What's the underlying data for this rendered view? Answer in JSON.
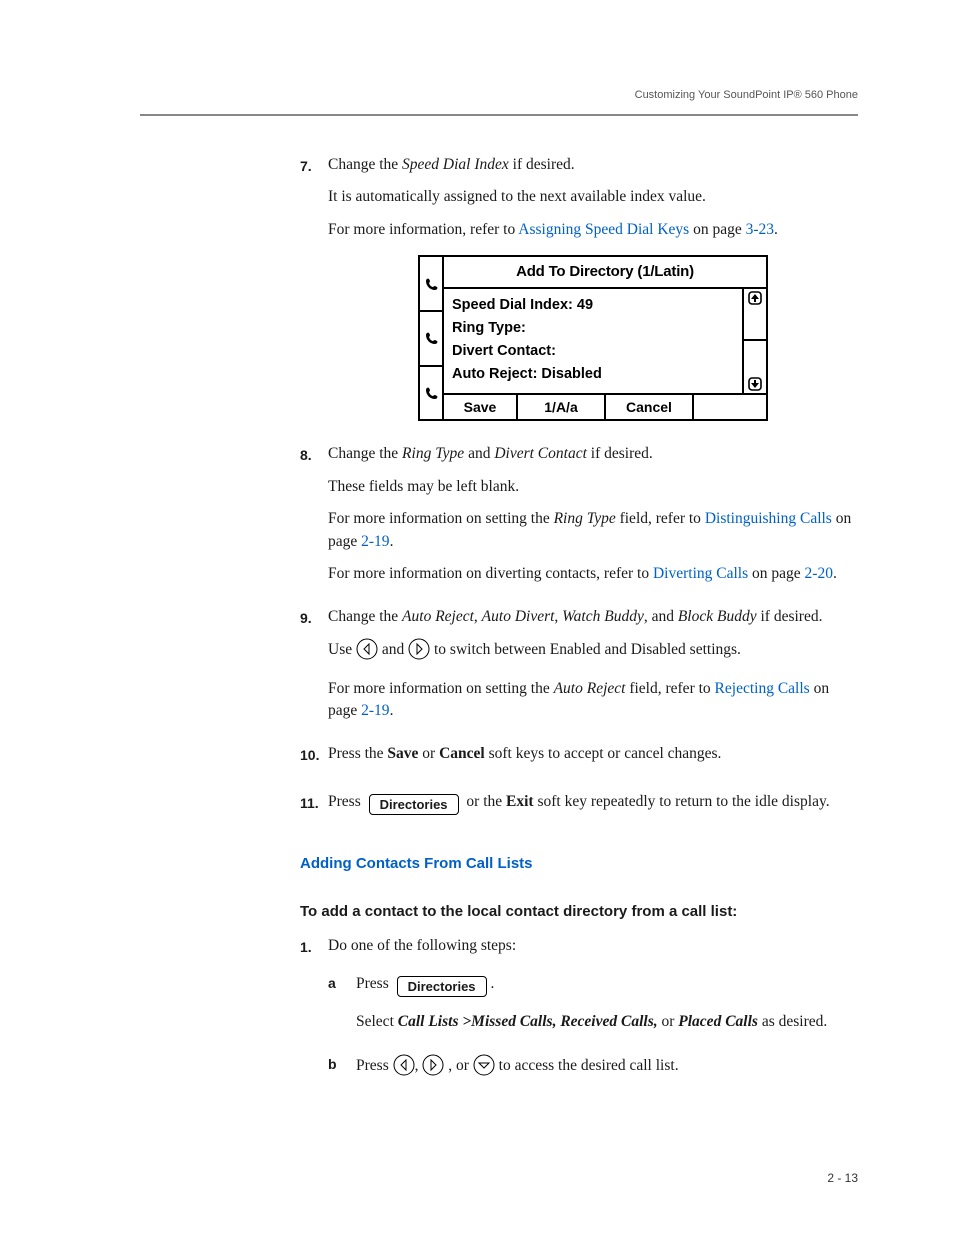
{
  "running_head": "Customizing Your SoundPoint IP® 560 Phone",
  "steps": {
    "seven": {
      "num": "7.",
      "intro_a": "Change the ",
      "intro_i": "Speed Dial Index",
      "intro_b": " if desired.",
      "p2": "It is automatically assigned to the next available index value.",
      "p3_a": "For more information, refer to ",
      "p3_link": "Assigning Speed Dial Keys",
      "p3_b": " on page ",
      "p3_page": "3-23",
      "p3_c": "."
    },
    "eight": {
      "num": "8.",
      "l1_a": "Change the ",
      "l1_i1": "Ring Type",
      "l1_b": " and ",
      "l1_i2": "Divert Contact",
      "l1_c": " if desired.",
      "p2": "These fields may be left blank.",
      "p3_a": "For more information on setting the ",
      "p3_i": "Ring Type",
      "p3_b": " field, refer to ",
      "p3_link": "Distinguishing Calls",
      "p3_c": " on page ",
      "p3_page": "2-19",
      "p3_d": ".",
      "p4_a": "For more information on diverting contacts, refer to ",
      "p4_link": "Diverting Calls",
      "p4_b": " on page ",
      "p4_page": "2-20",
      "p4_c": "."
    },
    "nine": {
      "num": "9.",
      "l1_a": "Change the ",
      "l1_i1": "Auto Reject",
      "l1_s1": ", ",
      "l1_i2": "Auto Divert",
      "l1_s2": ", ",
      "l1_i3": "Watch Buddy",
      "l1_s3": ", and ",
      "l1_i4": "Block Buddy",
      "l1_b": " if desired.",
      "p2_a": "Use ",
      "p2_b": " and ",
      "p2_c": "   to switch between Enabled and Disabled settings.",
      "p3_a": "For more information on setting the ",
      "p3_i": "Auto Reject",
      "p3_b": " field, refer to ",
      "p3_link": "Rejecting Calls",
      "p3_c": " on page ",
      "p3_page": "2-19",
      "p3_d": "."
    },
    "ten": {
      "num": "10.",
      "a": "Press the ",
      "b_save": "Save",
      "c": " or ",
      "b_cancel": "Cancel",
      "d": " soft keys to accept or cancel changes."
    },
    "eleven": {
      "num": "11.",
      "a": "Press ",
      "key": "Directories",
      "b": " or the ",
      "exit": "Exit",
      "c": " soft key repeatedly to return to the idle display."
    }
  },
  "lcd": {
    "title": "Add To Directory (1/Latin)",
    "line1": "Speed Dial Index: 49",
    "line2": "Ring Type:",
    "line3": "Divert Contact:",
    "line4": "Auto Reject: Disabled",
    "soft1": "Save",
    "soft2": "1/A/a",
    "soft3": "Cancel"
  },
  "section_hd": "Adding Contacts From Call Lists",
  "runin": "To add a contact to the local contact directory from a call list:",
  "step1": {
    "num": "1.",
    "text": "Do one of the following steps:"
  },
  "sub_a": {
    "num": "a",
    "press": "Press ",
    "key": "Directories",
    "dot": ".",
    "p2_a": "Select ",
    "p2_i": "Call Lists >Missed Calls, Received Calls,",
    "p2_b": " or ",
    "p2_i2": "Placed Calls",
    "p2_c": " as desired."
  },
  "sub_b": {
    "num": "b",
    "press": "Press ",
    "mid1": ", ",
    "mid2": " , or  ",
    "tail": "  to access the desired call list."
  },
  "footer": "2 - 13",
  "icons": {
    "phone": "phone-icon",
    "up": "arrow-up-icon",
    "down": "arrow-down-icon",
    "left": "arrow-left-icon",
    "right": "arrow-right-icon"
  },
  "chart_data": {
    "type": "table",
    "title": "Add To Directory (1/Latin)",
    "fields": [
      {
        "name": "Speed Dial Index",
        "value": "49"
      },
      {
        "name": "Ring Type",
        "value": ""
      },
      {
        "name": "Divert Contact",
        "value": ""
      },
      {
        "name": "Auto Reject",
        "value": "Disabled"
      }
    ],
    "softkeys": [
      "Save",
      "1/A/a",
      "Cancel"
    ]
  }
}
